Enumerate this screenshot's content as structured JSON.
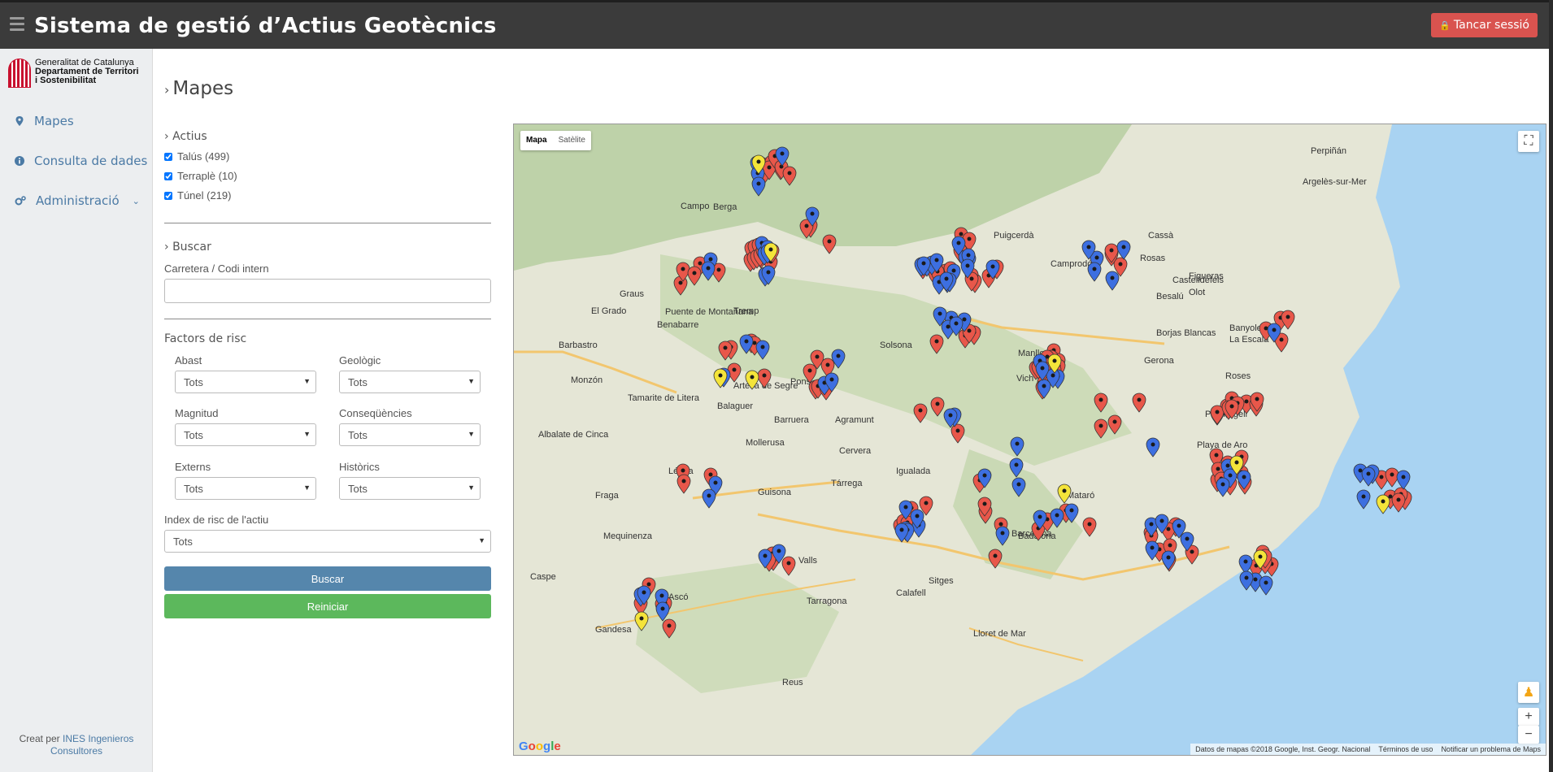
{
  "header": {
    "title": "Sistema de gestió d’Actius Geotècnics",
    "logout_label": "Tancar sessió",
    "logout_icon": "lock-icon"
  },
  "sidebar": {
    "logo": {
      "line1": "Generalitat de Catalunya",
      "line2": "Departament de Territori",
      "line3": "i Sostenibilitat"
    },
    "items": [
      {
        "label": "Mapes",
        "icon": "map-marker-icon"
      },
      {
        "label": "Consulta de dades",
        "icon": "info-circle-icon"
      },
      {
        "label": "Administració",
        "icon": "gears-icon"
      }
    ],
    "credit_prefix": "Creat per",
    "credit_link": "INES Ingenieros Consultores"
  },
  "main": {
    "title": "Mapes",
    "actius": {
      "heading": "Actius",
      "items": [
        {
          "label": "Talús (499)",
          "checked": true
        },
        {
          "label": "Terraplè (10)",
          "checked": true
        },
        {
          "label": "Túnel (219)",
          "checked": true
        }
      ]
    },
    "buscar": {
      "heading": "Buscar",
      "field_label": "Carretera / Codi intern",
      "field_value": ""
    },
    "factors": {
      "heading": "Factors de risc",
      "abast": {
        "label": "Abast",
        "value": "Tots"
      },
      "geologic": {
        "label": "Geològic",
        "value": "Tots"
      },
      "magnitud": {
        "label": "Magnitud",
        "value": "Tots"
      },
      "consequencies": {
        "label": "Conseqüències",
        "value": "Tots"
      },
      "externs": {
        "label": "Externs",
        "value": "Tots"
      },
      "historics": {
        "label": "Històrics",
        "value": "Tots"
      },
      "index": {
        "label": "Index de risc de l'actiu",
        "value": "Tots"
      }
    },
    "buttons": {
      "search": "Buscar",
      "reset": "Reiniciar"
    }
  },
  "map": {
    "tabs": {
      "map": "Mapa",
      "satellite": "Satèlite"
    },
    "fullscreen_icon": "fullscreen-icon",
    "pegman_icon": "pegman-icon",
    "zoom_in": "+",
    "zoom_out": "−",
    "logo": "Google",
    "footer": {
      "data": "Datos de mapas ©2018 Google, Inst. Geogr. Nacional",
      "terms": "Términos de uso",
      "report": "Notificar un problema de Maps"
    },
    "colors": {
      "sea": "#a9d3f2",
      "land": "#e5e6d6",
      "mountains": "#b9cfa4",
      "marker_red": "#e8574a",
      "marker_blue": "#3d6fe0",
      "marker_yellow": "#f4e43a"
    },
    "places": [
      "Perpiñán",
      "Argelès-sur-Mer",
      "Figueras",
      "Gerona",
      "Vich",
      "Manlleu",
      "Mataró",
      "Badalona",
      "Barcelona",
      "Sitges",
      "Igualada",
      "Cervera",
      "Tárrega",
      "Lérida",
      "Balaguer",
      "Tarragona",
      "Reus",
      "Valls",
      "Calafell",
      "Mollerusa",
      "Fraga",
      "Mequinenza",
      "Caspe",
      "Gandesa",
      "Ascó",
      "Benabarre",
      "Barbastro",
      "Monzón",
      "Tamarite de Litera",
      "Albalate de Cinca",
      "Puigcerdà",
      "Berga",
      "Solsona",
      "Pons",
      "Artesa de Segre",
      "Tremp",
      "Puente de Montañana",
      "El Grado",
      "Graus",
      "Campo",
      "Barruera",
      "Agramunt",
      "Guisona",
      "Borjas Blancas",
      "Olot",
      "Besalú",
      "Banyoles",
      "La Escala",
      "Roses",
      "Palafrugell",
      "Playa de Aro",
      "Lloret de Mar",
      "Castelldefels",
      "Cassà",
      "Rosas",
      "Camprodón"
    ],
    "markers": {
      "red": 499,
      "blue": 219,
      "yellow": 10
    }
  }
}
